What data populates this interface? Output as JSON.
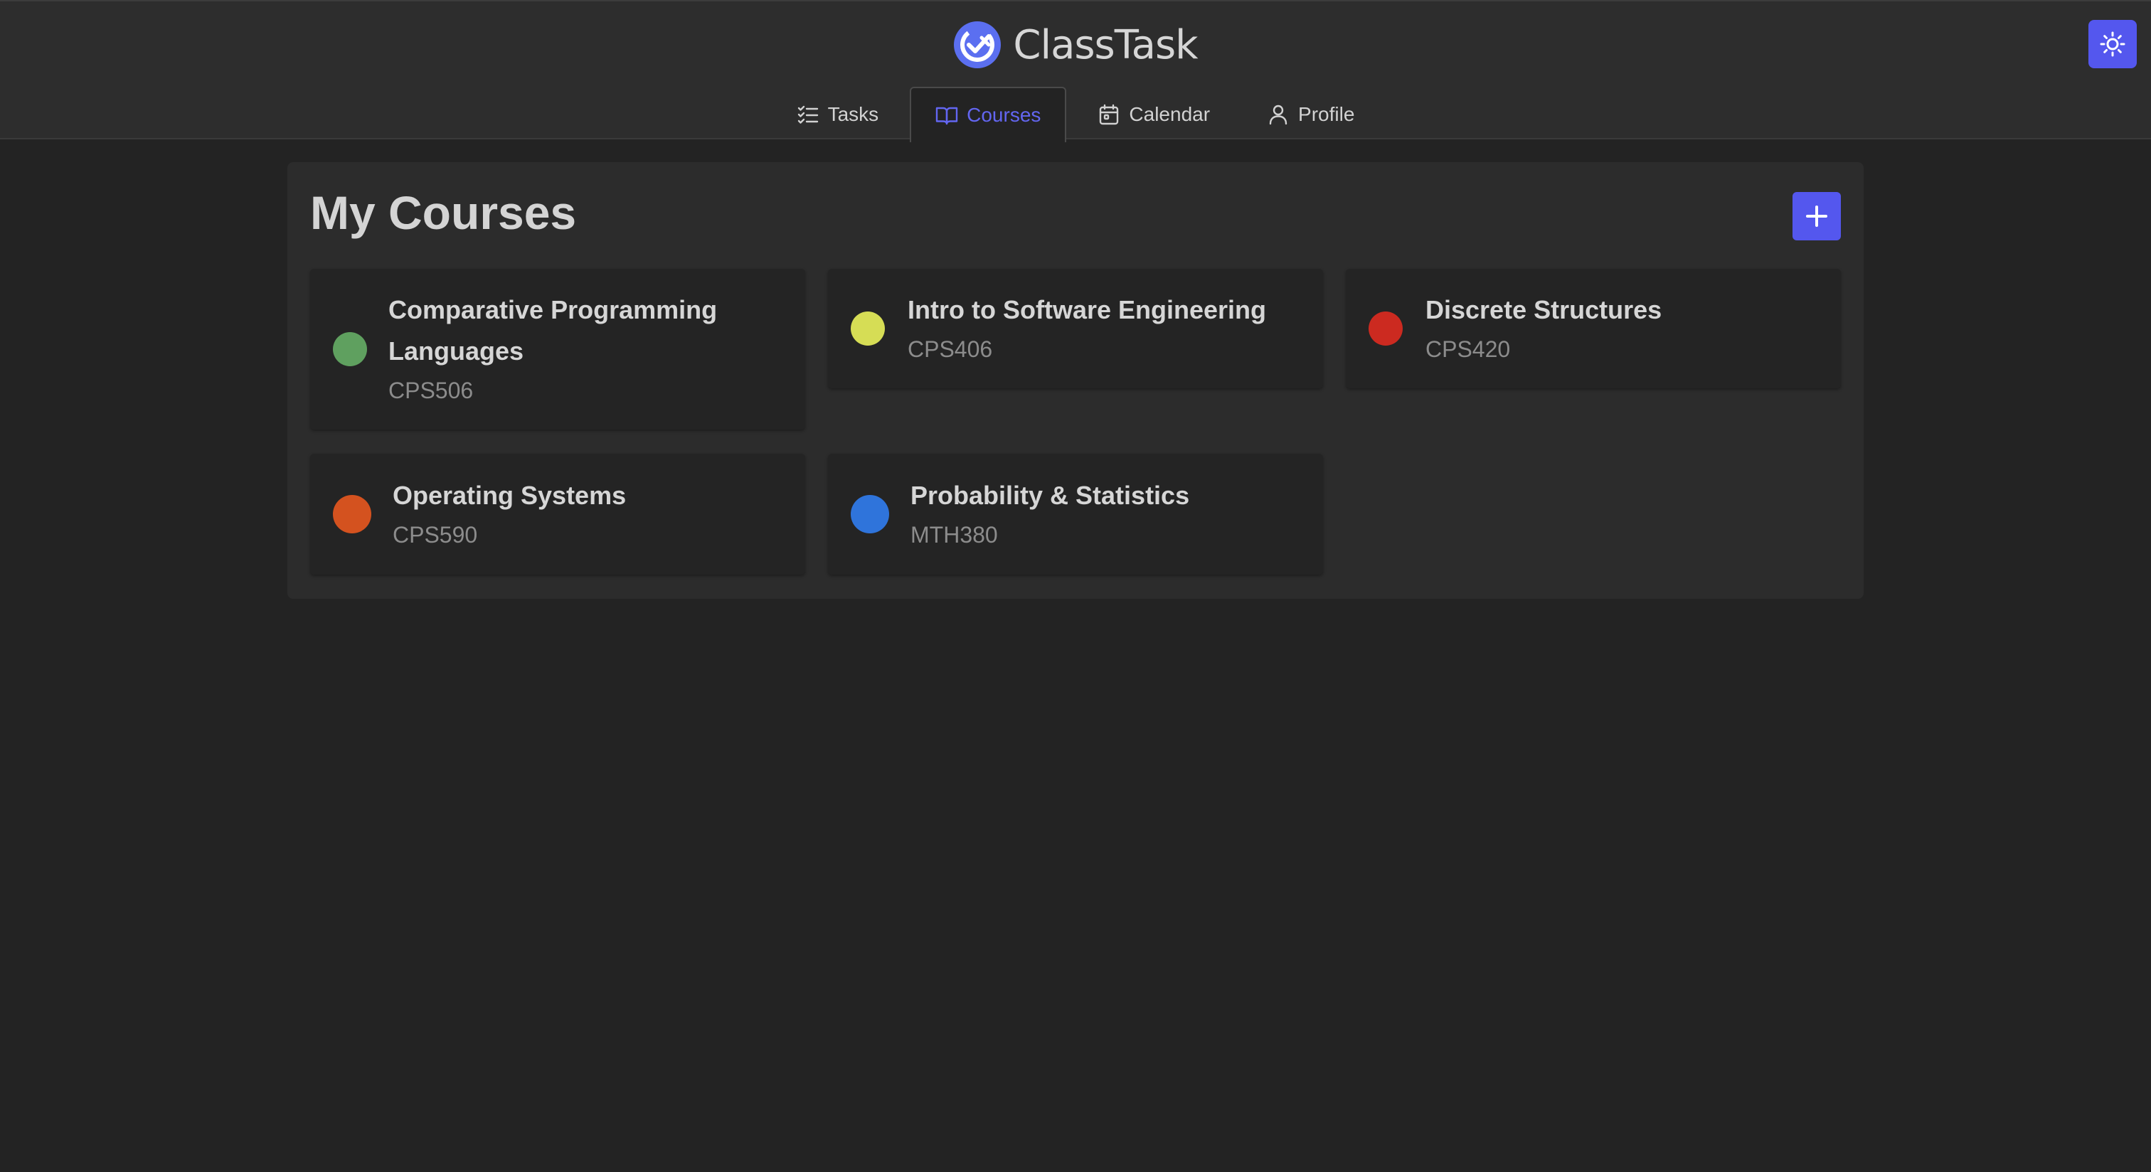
{
  "app": {
    "name": "ClassTask",
    "accent_color": "#5457ee",
    "logo_icon": "check-x-circle-icon"
  },
  "theme_toggle": {
    "icon": "sun-icon"
  },
  "nav": {
    "tabs": [
      {
        "label": "Tasks",
        "icon": "list-checks-icon",
        "active": false
      },
      {
        "label": "Courses",
        "icon": "book-open-icon",
        "active": true
      },
      {
        "label": "Calendar",
        "icon": "calendar-icon",
        "active": false
      },
      {
        "label": "Profile",
        "icon": "user-icon",
        "active": false
      }
    ]
  },
  "main": {
    "title": "My Courses",
    "add_button_icon": "plus-icon",
    "courses": [
      {
        "name": "Comparative Programming Languages",
        "code": "CPS506",
        "color": "#5fa05f"
      },
      {
        "name": "Intro to Software Engineering",
        "code": "CPS406",
        "color": "#d6dd55"
      },
      {
        "name": "Discrete Structures",
        "code": "CPS420",
        "color": "#cc2a20"
      },
      {
        "name": "Operating Systems",
        "code": "CPS590",
        "color": "#d4521f"
      },
      {
        "name": "Probability & Statistics",
        "code": "MTH380",
        "color": "#2f74db"
      }
    ]
  }
}
